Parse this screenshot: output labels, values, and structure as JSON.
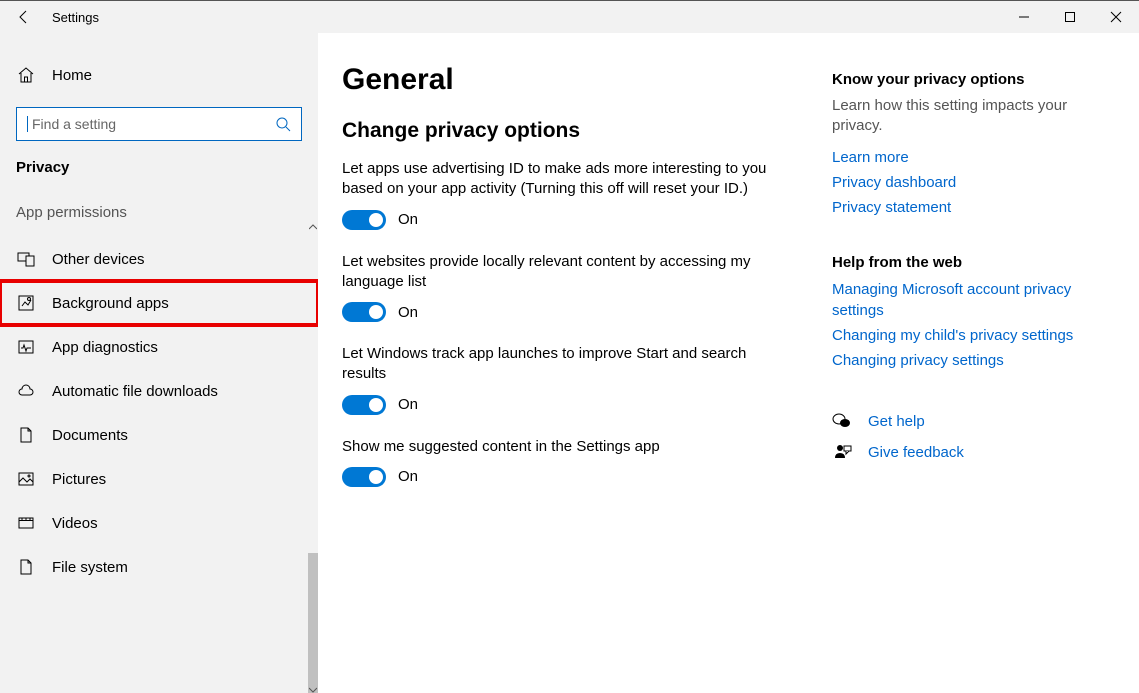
{
  "titlebar": {
    "title": "Settings"
  },
  "sidebar": {
    "home": "Home",
    "search_placeholder": "Find a setting",
    "category": "Privacy",
    "subheader": "App permissions",
    "items": [
      {
        "label": "Other devices"
      },
      {
        "label": "Background apps"
      },
      {
        "label": "App diagnostics"
      },
      {
        "label": "Automatic file downloads"
      },
      {
        "label": "Documents"
      },
      {
        "label": "Pictures"
      },
      {
        "label": "Videos"
      },
      {
        "label": "File system"
      }
    ]
  },
  "main": {
    "title": "General",
    "section": "Change privacy options",
    "toggles": [
      {
        "desc": "Let apps use advertising ID to make ads more interesting to you based on your app activity (Turning this off will reset your ID.)",
        "state": "On"
      },
      {
        "desc": "Let websites provide locally relevant content by accessing my language list",
        "state": "On"
      },
      {
        "desc": "Let Windows track app launches to improve Start and search results",
        "state": "On"
      },
      {
        "desc": "Show me suggested content in the Settings app",
        "state": "On"
      }
    ]
  },
  "aside": {
    "know": {
      "title": "Know your privacy options",
      "desc": "Learn how this setting impacts your privacy.",
      "links": [
        "Learn more",
        "Privacy dashboard",
        "Privacy statement"
      ]
    },
    "help": {
      "title": "Help from the web",
      "links": [
        "Managing Microsoft account privacy settings",
        "Changing my child's privacy settings",
        "Changing privacy settings"
      ]
    },
    "feedback": {
      "get_help": "Get help",
      "give_feedback": "Give feedback"
    }
  }
}
